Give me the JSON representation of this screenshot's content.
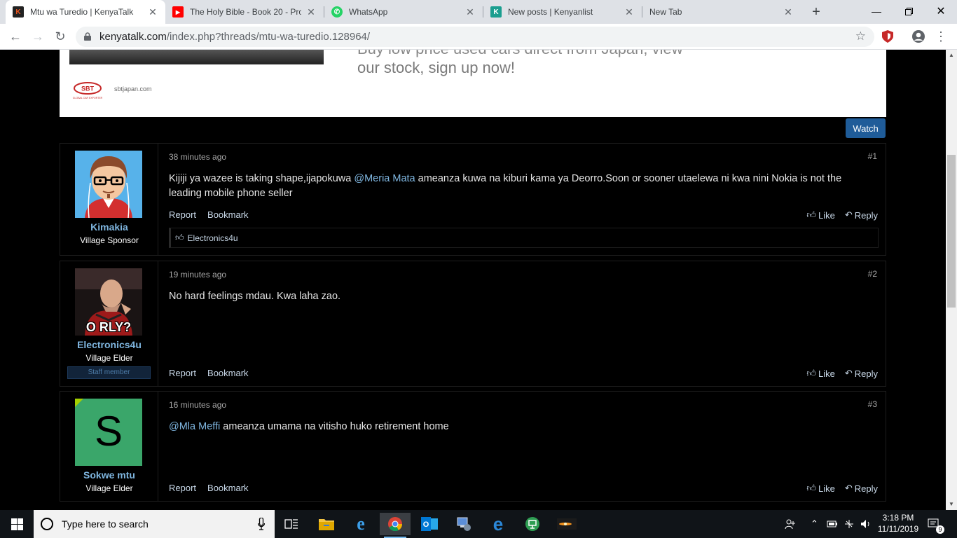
{
  "browser": {
    "tabs": [
      {
        "label": "Mtu wa Turedio | KenyaTalk",
        "icon": "kenyatalk-k-icon",
        "color": "#e8541f",
        "glyph": "K"
      },
      {
        "label": "The Holy Bible - Book 20 - Pro",
        "icon": "youtube-icon",
        "color": "#ff0000",
        "glyph": "▶"
      },
      {
        "label": "WhatsApp",
        "icon": "whatsapp-icon",
        "color": "#25d366",
        "glyph": "✆"
      },
      {
        "label": "New posts | Kenyanlist",
        "icon": "kenyanlist-k-icon",
        "color": "#1a9e8f",
        "glyph": "K"
      },
      {
        "label": "New Tab",
        "icon": "",
        "color": "",
        "glyph": ""
      }
    ],
    "url_host": "kenyatalk.com",
    "url_path": "/index.php?threads/mtu-wa-turedio.128964/"
  },
  "ad": {
    "text_top": "Buy low price used cars direct from Japan, view",
    "text": "our stock, sign up now!",
    "domain": "sbtjapan.com",
    "logo_text": "SBT",
    "logo_sub": "GLOBAL CAR EXPORTER"
  },
  "watch_label": "Watch",
  "posts": [
    {
      "time": "38 minutes ago",
      "num": "#1",
      "username": "Kimakia",
      "user_title": "Village Sponsor",
      "body_before": "Kijiji ya wazee is taking shape,ijapokuwa ",
      "mention": "@Meria Mata",
      "body_after": " ameanza kuwa na kiburi kama ya Deorro.Soon or sooner utaelewa ni kwa nini Nokia is not the leading mobile phone seller",
      "liked_by": "Electronics4u"
    },
    {
      "time": "19 minutes ago",
      "num": "#2",
      "username": "Electronics4u",
      "user_title": "Village Elder",
      "staff_label": "Staff member",
      "avatar_caption": "O RLY?",
      "body": "No hard feelings mdau. Kwa laha zao."
    },
    {
      "time": "16 minutes ago",
      "num": "#3",
      "username": "Sokwe mtu",
      "user_title": "Village Elder",
      "avatar_letter": "S",
      "mention": "@Mla Meffi",
      "body_after": " ameanza umama na vitisho huko retirement home"
    }
  ],
  "actions": {
    "report": "Report",
    "bookmark": "Bookmark",
    "like": "Like",
    "reply": "Reply"
  },
  "taskbar": {
    "search_placeholder": "Type here to search",
    "time": "3:18 PM",
    "date": "11/11/2019",
    "notification_count": "9"
  }
}
